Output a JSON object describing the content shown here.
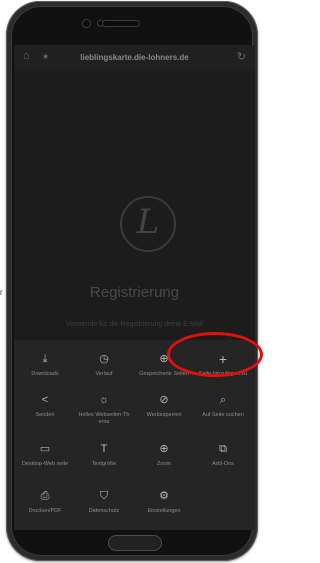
{
  "browser": {
    "url": "lieblingskarte.die-lohners.de",
    "home_icon": "home-icon",
    "star_icon": "star-icon",
    "reload_icon": "reload-icon"
  },
  "page": {
    "logo_letter": "L",
    "title": "Registrierung",
    "subtitle": "Verwende für die Registrierung deine E-Mail"
  },
  "menu": {
    "items": [
      {
        "label": "Downloads",
        "icon": "download-icon",
        "glyph": "⤓"
      },
      {
        "label": "Verlauf",
        "icon": "clock-icon",
        "glyph": "◷"
      },
      {
        "label": "Gespeicherte Seiten",
        "icon": "globe-icon",
        "glyph": "⊕"
      },
      {
        "label": "Seite hinzufügen zu",
        "icon": "plus-icon",
        "glyph": "+"
      },
      {
        "label": "Senden",
        "icon": "share-icon",
        "glyph": "<"
      },
      {
        "label": "Helles Webseiten-Th ema",
        "icon": "sun-icon",
        "glyph": "☼"
      },
      {
        "label": "Werbesperren",
        "icon": "block-icon",
        "glyph": "⊘"
      },
      {
        "label": "Auf Seite suchen",
        "icon": "find-icon",
        "glyph": "⌕"
      },
      {
        "label": "Desktop-Web seite",
        "icon": "desktop-icon",
        "glyph": "▭"
      },
      {
        "label": "Textgröße",
        "icon": "text-size-icon",
        "glyph": "T"
      },
      {
        "label": "Zoom",
        "icon": "zoom-icon",
        "glyph": "⊕"
      },
      {
        "label": "Add-Ons",
        "icon": "addon-icon",
        "glyph": "⧉"
      },
      {
        "label": "Drucken/PDF",
        "icon": "print-icon",
        "glyph": "⎙"
      },
      {
        "label": "Datenschutz",
        "icon": "shield-icon",
        "glyph": "⛉"
      },
      {
        "label": "Einstellungen",
        "icon": "settings-icon",
        "glyph": "⚙"
      }
    ]
  },
  "edge_text": "r",
  "highlight_color": "#e20f0f"
}
